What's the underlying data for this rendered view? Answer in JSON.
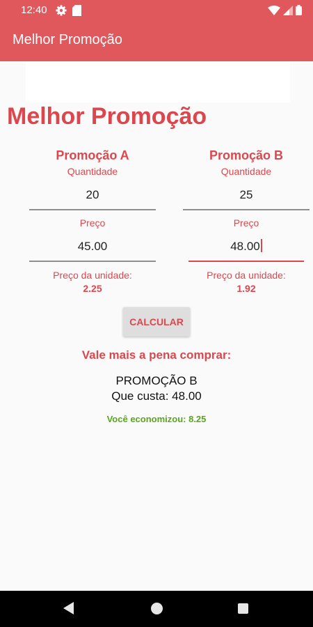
{
  "status_bar": {
    "time": "12:40",
    "icons": [
      "gear-icon",
      "sd-card-icon",
      "wifi-icon",
      "signal-icon",
      "battery-icon"
    ]
  },
  "app_bar": {
    "title": "Melhor Promoção"
  },
  "page": {
    "heading": "Melhor Promoção"
  },
  "promo_a": {
    "title": "Promoção A",
    "quantity_label": "Quantidade",
    "quantity_value": "20",
    "price_label": "Preço",
    "price_value": "45.00",
    "unit_label": "Preço da unidade:",
    "unit_value": "2.25"
  },
  "promo_b": {
    "title": "Promoção B",
    "quantity_label": "Quantidade",
    "quantity_value": "25",
    "price_label": "Preço",
    "price_value": "48.00",
    "unit_label": "Preço da unidade:",
    "unit_value": "1.92"
  },
  "calculate": {
    "label": "CALCULAR"
  },
  "result": {
    "heading": "Vale mais a pena comprar:",
    "winner": "PROMOÇÃO B",
    "cost": "Que custa: 48.00",
    "savings": "Você economizou: 8.25"
  },
  "colors": {
    "primary": "#e0575c",
    "accent": "#dc474d",
    "savings": "#5aa51f"
  }
}
